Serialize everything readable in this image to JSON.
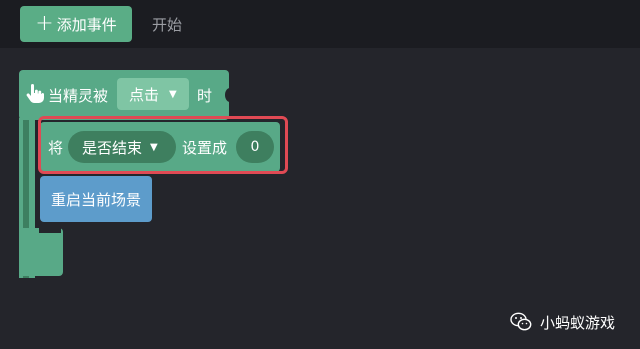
{
  "toolbar": {
    "add_event_icon": "plus-icon",
    "add_event_label": "添加事件",
    "start_tab_label": "开始"
  },
  "event_block": {
    "icon": "hand-pointer-icon",
    "prefix": "当精灵被",
    "dropdown_value": "点击",
    "suffix": "时"
  },
  "set_block": {
    "prefix": "将",
    "variable": "是否结束",
    "middle": "设置成",
    "value": "0"
  },
  "restart_block": {
    "label": "重启当前场景"
  },
  "watermark": {
    "icon": "wechat-icon",
    "text": "小蚂蚁游戏"
  },
  "colors": {
    "event_green": "#58a987",
    "dropdown_green": "#7fc5a4",
    "input_dark_green": "#3e7f5f",
    "action_blue": "#5d9ccb",
    "highlight_red": "#e04a54",
    "background": "#24252b"
  }
}
